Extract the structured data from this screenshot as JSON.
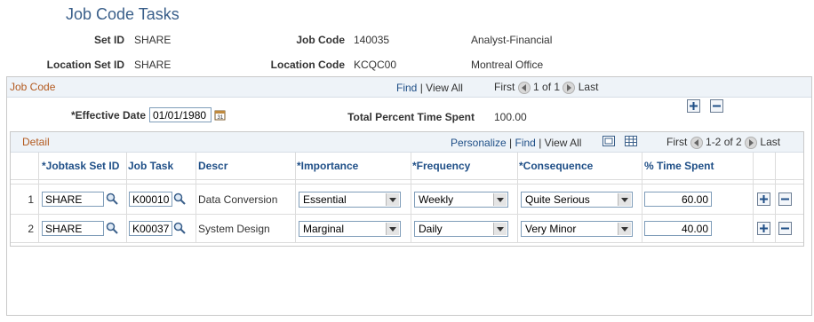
{
  "page": {
    "title": "Job Code Tasks"
  },
  "header": {
    "setid_label": "Set ID",
    "setid_value": "SHARE",
    "jobcode_label": "Job Code",
    "jobcode_value": "140035",
    "jobcode_descr": "Analyst-Financial",
    "locsetid_label": "Location Set ID",
    "locsetid_value": "SHARE",
    "loccode_label": "Location Code",
    "loccode_value": "KCQC00",
    "loccode_descr": "Montreal Office"
  },
  "jobcode_section": {
    "title": "Job Code",
    "find": "Find",
    "view_all": "View All",
    "sep": "|",
    "first": "First",
    "range": "1 of 1",
    "last": "Last",
    "effdt_label": "*Effective Date",
    "effdt_value": "01/01/1980",
    "total_label": "Total Percent Time Spent",
    "total_value": "100.00"
  },
  "detail": {
    "title": "Detail",
    "personalize": "Personalize",
    "find": "Find",
    "view_all": "View All",
    "sep": "|",
    "first": "First",
    "range": "1-2 of 2",
    "last": "Last",
    "columns": [
      "*Jobtask Set ID",
      "Job Task",
      "Descr",
      "*Importance",
      "*Frequency",
      "*Consequence",
      "% Time Spent"
    ],
    "rows": [
      {
        "num": "1",
        "setid": "SHARE",
        "task": "K00010",
        "descr": "Data Conversion",
        "importance": "Essential",
        "frequency": "Weekly",
        "consequence": "Quite Serious",
        "pct": "60.00"
      },
      {
        "num": "2",
        "setid": "SHARE",
        "task": "K00037",
        "descr": "System Design",
        "importance": "Marginal",
        "frequency": "Daily",
        "consequence": "Very Minor",
        "pct": "40.00"
      }
    ]
  },
  "icons": {
    "lookup": "magnifier-icon",
    "calendar": "calendar-icon",
    "add": "plus-icon",
    "delete": "minus-icon",
    "prev": "left-arrow-icon",
    "next": "right-arrow-icon",
    "zoom": "view-grid-icon",
    "download": "download-excel-icon"
  }
}
